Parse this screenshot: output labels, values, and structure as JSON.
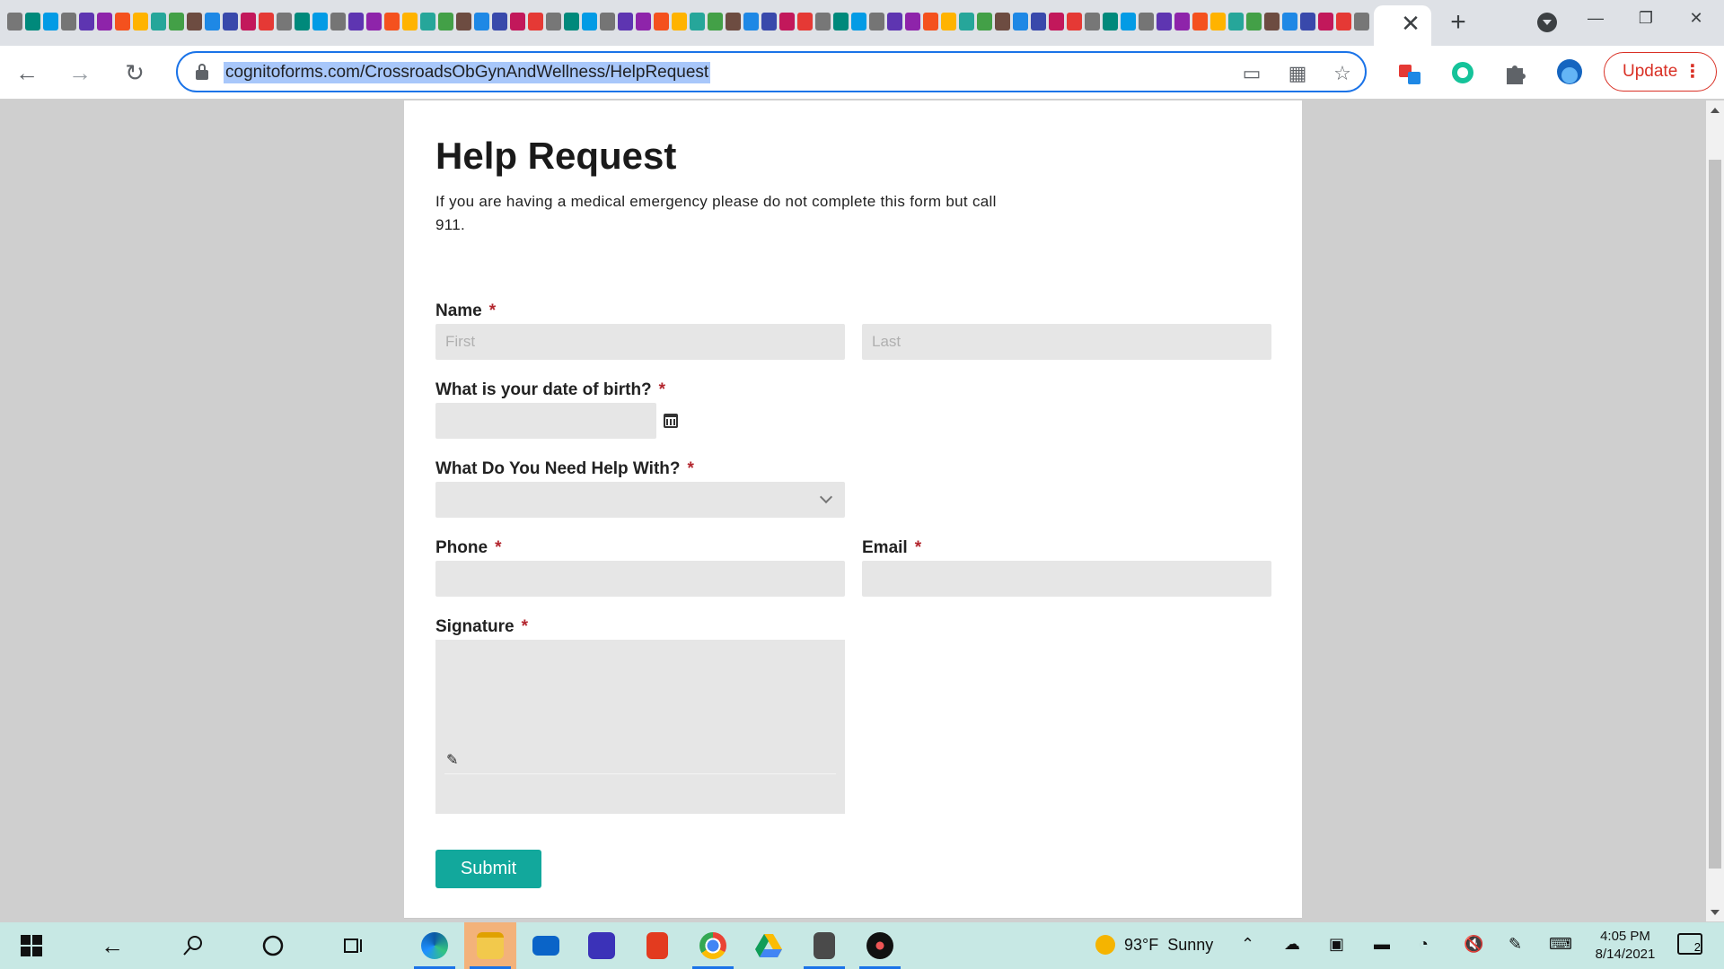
{
  "browser": {
    "tab_close_glyph": "✕",
    "new_tab_glyph": "+",
    "window_minimize": "—",
    "window_restore": "❐",
    "window_close": "✕",
    "url": "cognitoforms.com/CrossroadsObGynAndWellness/HelpRequest",
    "update_label": "Update",
    "nav": {
      "back": "←",
      "forward": "→",
      "reload": "↻"
    }
  },
  "form": {
    "title": "Help Request",
    "description": "If you are having a medical emergency please do not complete this form but call 911.",
    "required_marker": "*",
    "fields": {
      "name": {
        "label": "Name",
        "first_placeholder": "First",
        "last_placeholder": "Last"
      },
      "dob": {
        "label": "What is your date of birth?"
      },
      "help": {
        "label": "What Do You Need Help With?"
      },
      "phone": {
        "label": "Phone"
      },
      "email": {
        "label": "Email"
      },
      "signature": {
        "label": "Signature"
      }
    },
    "submit_label": "Submit",
    "accent_color": "#12a89c"
  },
  "taskbar": {
    "weather": {
      "temperature": "93°F",
      "condition": "Sunny"
    },
    "clock": {
      "time": "4:05 PM",
      "date": "8/14/2021"
    },
    "notification_count": "2"
  }
}
